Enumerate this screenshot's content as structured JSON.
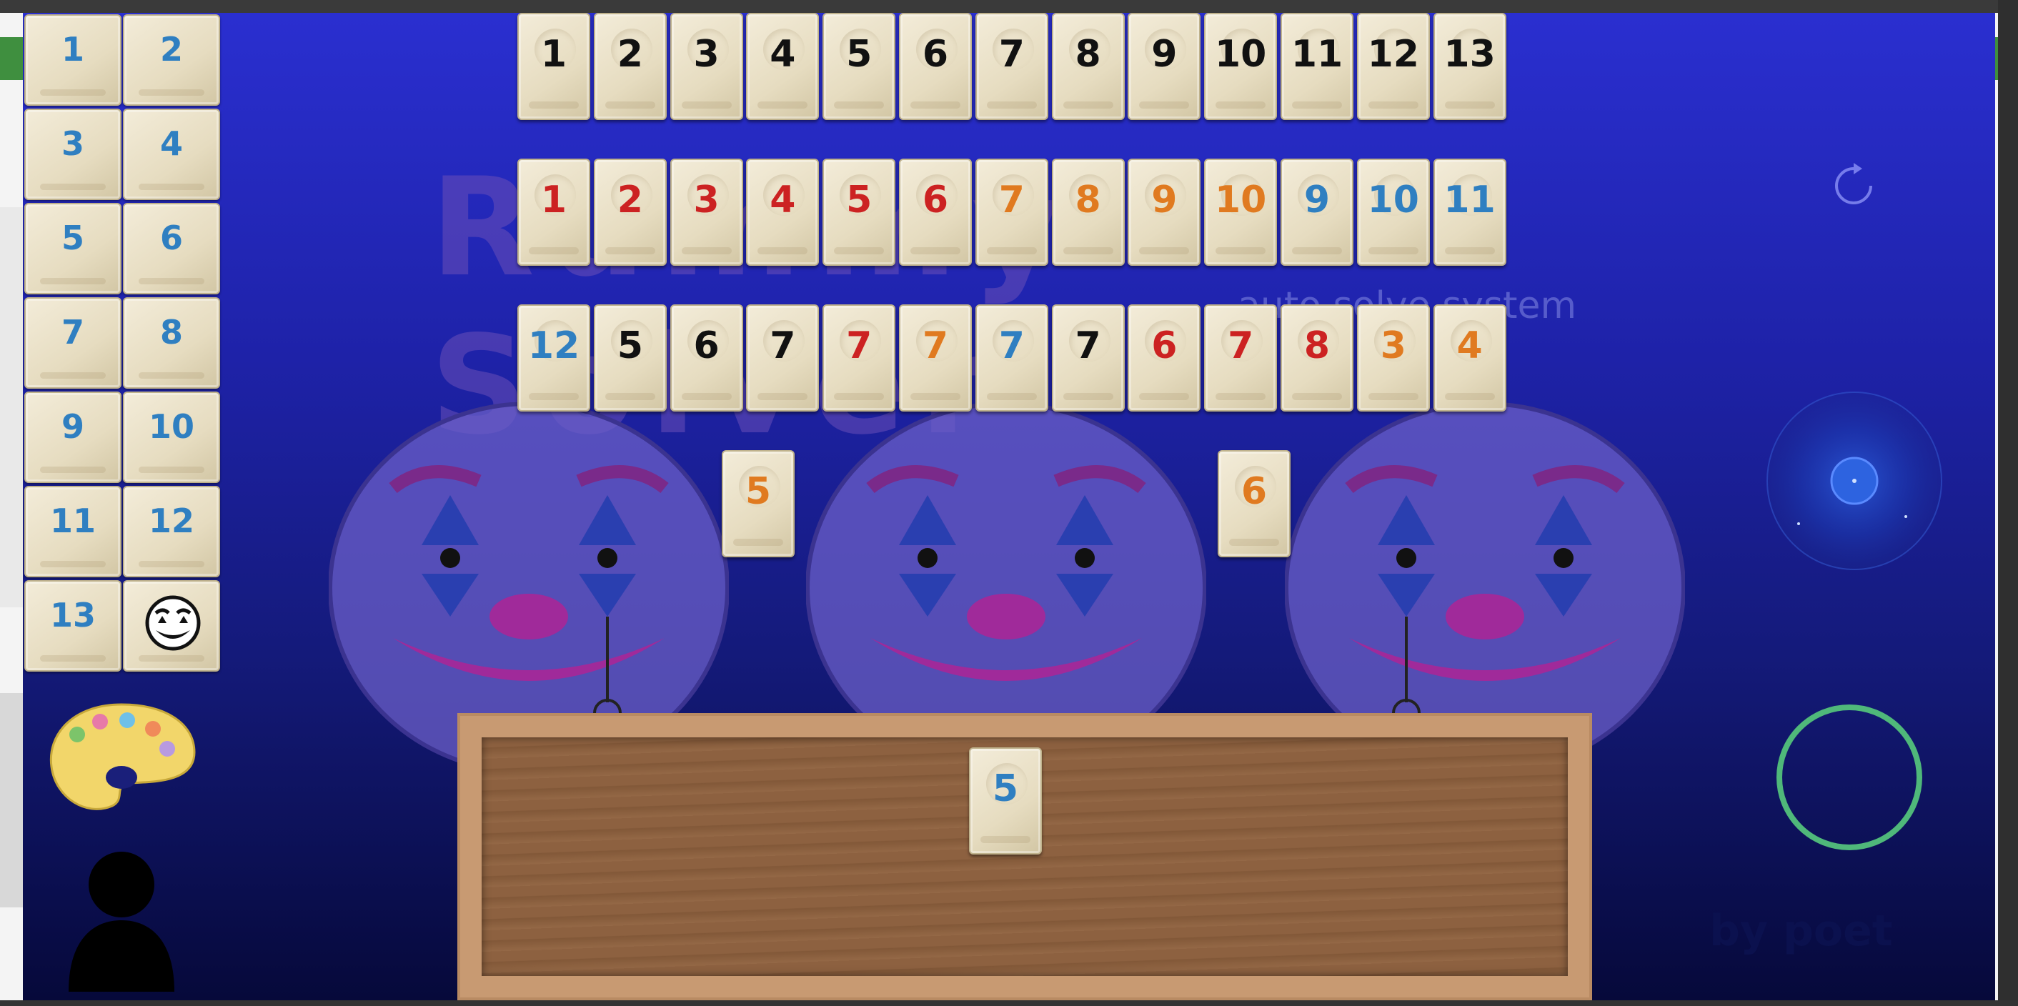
{
  "logo": {
    "title": "Rummy Solver",
    "subtitle": "auto solve system",
    "credit": "by poet"
  },
  "sidebar": {
    "tiles": [
      "1",
      "2",
      "3",
      "4",
      "5",
      "6",
      "7",
      "8",
      "9",
      "10",
      "11",
      "12",
      "13"
    ],
    "joker_icon": "joker-face-icon"
  },
  "board": {
    "row1": [
      {
        "n": "1",
        "c": "#111111"
      },
      {
        "n": "2",
        "c": "#111111"
      },
      {
        "n": "3",
        "c": "#111111"
      },
      {
        "n": "4",
        "c": "#111111"
      },
      {
        "n": "5",
        "c": "#111111"
      },
      {
        "n": "6",
        "c": "#111111"
      },
      {
        "n": "7",
        "c": "#111111"
      },
      {
        "n": "8",
        "c": "#111111"
      },
      {
        "n": "9",
        "c": "#111111"
      },
      {
        "n": "10",
        "c": "#111111"
      },
      {
        "n": "11",
        "c": "#111111"
      },
      {
        "n": "12",
        "c": "#111111"
      },
      {
        "n": "13",
        "c": "#111111"
      }
    ],
    "row2": [
      {
        "n": "1",
        "c": "#cc2222"
      },
      {
        "n": "2",
        "c": "#cc2222"
      },
      {
        "n": "3",
        "c": "#cc2222"
      },
      {
        "n": "4",
        "c": "#cc2222"
      },
      {
        "n": "5",
        "c": "#cc2222"
      },
      {
        "n": "6",
        "c": "#cc2222"
      },
      {
        "n": "7",
        "c": "#e07a20"
      },
      {
        "n": "8",
        "c": "#e07a20"
      },
      {
        "n": "9",
        "c": "#e07a20"
      },
      {
        "n": "10",
        "c": "#e07a20"
      },
      {
        "n": "9",
        "c": "#2f7fc1"
      },
      {
        "n": "10",
        "c": "#2f7fc1"
      },
      {
        "n": "11",
        "c": "#2f7fc1"
      }
    ],
    "row3": [
      {
        "n": "12",
        "c": "#2f7fc1"
      },
      {
        "n": "5",
        "c": "#111111"
      },
      {
        "n": "6",
        "c": "#111111"
      },
      {
        "n": "7",
        "c": "#111111"
      },
      {
        "n": "7",
        "c": "#cc2222"
      },
      {
        "n": "7",
        "c": "#e07a20"
      },
      {
        "n": "7",
        "c": "#2f7fc1"
      },
      {
        "n": "7",
        "c": "#111111"
      },
      {
        "n": "6",
        "c": "#cc2222"
      },
      {
        "n": "7",
        "c": "#cc2222"
      },
      {
        "n": "8",
        "c": "#cc2222"
      },
      {
        "n": "3",
        "c": "#e07a20"
      },
      {
        "n": "4",
        "c": "#e07a20"
      }
    ]
  },
  "loose_tiles": [
    {
      "n": "5",
      "c": "#e07a20"
    },
    {
      "n": "6",
      "c": "#e07a20"
    }
  ],
  "rack_tiles": [
    {
      "n": "5",
      "c": "#2f7fc1"
    }
  ],
  "colors": {
    "black": "#111111",
    "red": "#cc2222",
    "orange": "#e07a20",
    "blue": "#2f7fc1"
  },
  "icons": {
    "refresh": "refresh-icon",
    "radar": "radar-icon",
    "ring": "ring-button-icon",
    "palette": "palette-icon",
    "user": "user-icon"
  }
}
